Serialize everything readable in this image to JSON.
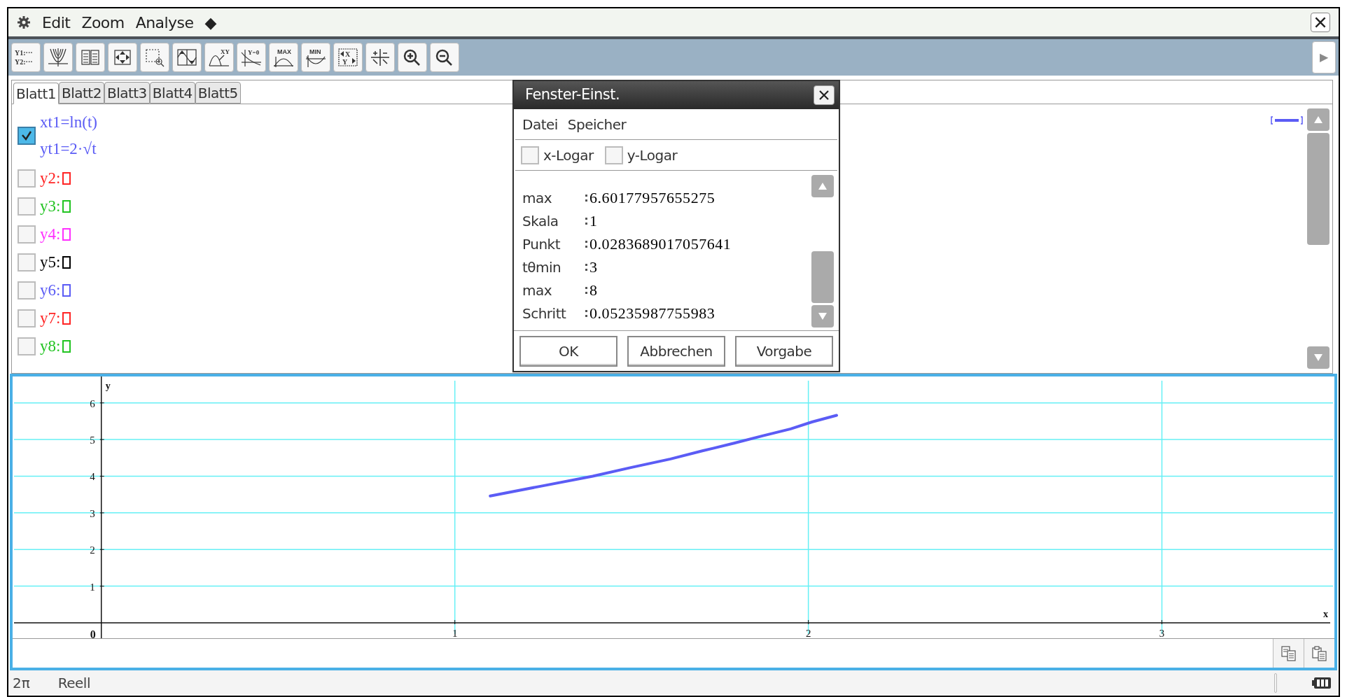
{
  "menu": [
    "Edit",
    "Zoom",
    "Analyse",
    "◆"
  ],
  "toolbar": [
    {
      "kind": "yeditor",
      "labels": [
        "Y1:···",
        "Y2:···"
      ]
    },
    {
      "kind": "family"
    },
    {
      "kind": "table"
    },
    {
      "kind": "zoom-auto"
    },
    {
      "kind": "zoom-box"
    },
    {
      "kind": "sketch"
    },
    {
      "kind": "intersect",
      "labels": [
        "XY"
      ]
    },
    {
      "kind": "root",
      "labels": [
        "Y=0"
      ]
    },
    {
      "kind": "max",
      "labels": [
        "MAX"
      ]
    },
    {
      "kind": "min",
      "labels": [
        "MIN"
      ]
    },
    {
      "kind": "swap",
      "labels": [
        "X",
        "Y"
      ]
    },
    {
      "kind": "fit"
    },
    {
      "kind": "zoom-in"
    },
    {
      "kind": "zoom-out"
    }
  ],
  "toolbar_more": {
    "label": "▶",
    "disabled": true
  },
  "tabs": [
    {
      "label": "Blatt1",
      "selected": true
    },
    {
      "label": "Blatt2",
      "selected": false
    },
    {
      "label": "Blatt3",
      "selected": false
    },
    {
      "label": "Blatt4",
      "selected": false
    },
    {
      "label": "Blatt5",
      "selected": false
    }
  ],
  "functions": [
    {
      "kind": "parametric",
      "checked": true,
      "color": "#5b5cf5",
      "lines": [
        "xt1=ln(t)",
        "yt1=2·√t"
      ]
    },
    {
      "kind": "empty",
      "checked": false,
      "color": "#ff2424",
      "lines": [
        "y2:"
      ]
    },
    {
      "kind": "empty",
      "checked": false,
      "color": "#22c422",
      "lines": [
        "y3:"
      ]
    },
    {
      "kind": "empty",
      "checked": false,
      "color": "#ff30ff",
      "lines": [
        "y4:"
      ]
    },
    {
      "kind": "empty",
      "checked": false,
      "color": "#000000",
      "lines": [
        "y5:"
      ]
    },
    {
      "kind": "empty",
      "checked": false,
      "color": "#5b5cf5",
      "lines": [
        "y6:"
      ]
    },
    {
      "kind": "empty",
      "checked": false,
      "color": "#ff2424",
      "lines": [
        "y7:"
      ]
    },
    {
      "kind": "empty",
      "checked": false,
      "color": "#22c422",
      "lines": [
        "y8:"
      ]
    }
  ],
  "dialog": {
    "title": "Fenster-Einst.",
    "menu": [
      "Datei",
      "Speicher"
    ],
    "options": [
      {
        "label": "x-Logar",
        "checked": false
      },
      {
        "label": "y-Logar",
        "checked": false
      }
    ],
    "fields": [
      {
        "label": "max",
        "value": "6.60177957655275"
      },
      {
        "label": "Skala",
        "value": "1"
      },
      {
        "label": "Punkt",
        "value": "0.0283689017057641"
      },
      {
        "label": "tθmin",
        "value": "3"
      },
      {
        "label": "max",
        "value": "8"
      },
      {
        "label": "Schritt",
        "value": "0.05235987755983"
      }
    ],
    "buttons": [
      "OK",
      "Abbrechen",
      "Vorgabe"
    ]
  },
  "graph": {
    "chart_data": {
      "type": "line",
      "xlabel": "x",
      "ylabel": "y",
      "x": [
        1.1,
        1.25,
        1.39,
        1.5,
        1.61,
        1.7,
        1.79,
        1.87,
        1.95,
        2.01,
        2.08
      ],
      "series": [
        {
          "color": "#5b5cf5",
          "values": [
            3.46,
            3.74,
            4.0,
            4.24,
            4.47,
            4.69,
            4.9,
            5.1,
            5.29,
            5.48,
            5.66
          ]
        }
      ],
      "grid": true,
      "xlim": [
        -0.247,
        3.484
      ],
      "ylim": [
        -0.42,
        6.72
      ],
      "xticks": [
        {
          "value": 0,
          "label": "0"
        },
        1,
        2,
        3
      ],
      "yticks": [
        1,
        2,
        3,
        4,
        5,
        6
      ]
    }
  },
  "status_bar": {
    "angle": "2π",
    "mode": "Reell"
  }
}
